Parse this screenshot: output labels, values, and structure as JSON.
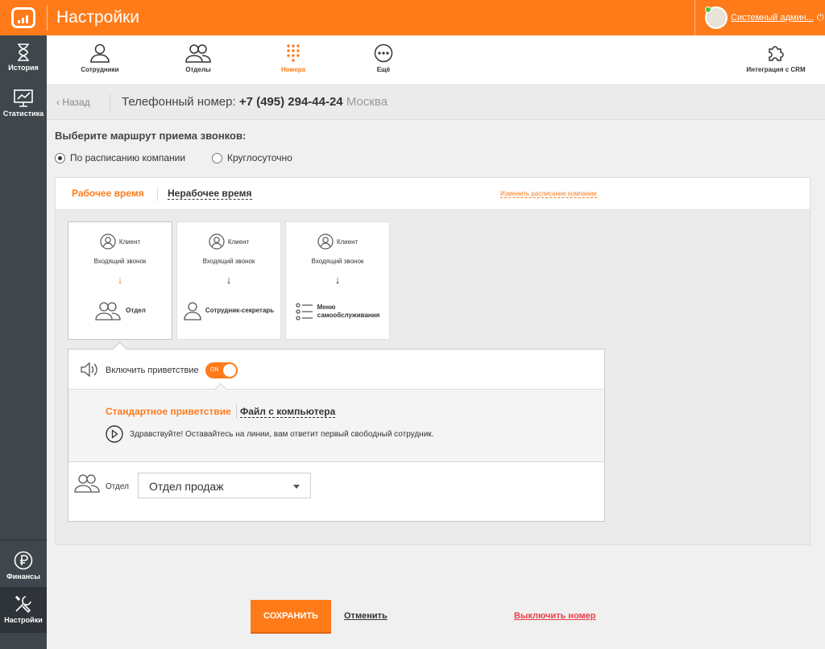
{
  "header": {
    "title": "Настройки",
    "user_name": "Системный админ..."
  },
  "sidebar": {
    "items": [
      {
        "label": "История",
        "icon": "hourglass-icon"
      },
      {
        "label": "Статистика",
        "icon": "chart-icon"
      },
      {
        "label": "Финансы",
        "icon": "ruble-icon"
      },
      {
        "label": "Настройки",
        "icon": "tools-icon"
      }
    ]
  },
  "subnav": {
    "items": [
      {
        "label": "Сотрудники",
        "icon": "user-icon"
      },
      {
        "label": "Отделы",
        "icon": "users-icon"
      },
      {
        "label": "Номера",
        "icon": "keypad-icon"
      },
      {
        "label": "Ещё",
        "icon": "more-icon"
      },
      {
        "label": "Интеграция с CRM",
        "icon": "puzzle-icon"
      }
    ],
    "active": "Номера"
  },
  "breadcrumb": {
    "back": "Назад",
    "prefix": "Телефонный номер:",
    "number": "+7 (495) 294-44-24",
    "city": "Москва"
  },
  "route": {
    "title": "Выберите маршрут приема звонков:",
    "options": [
      "По расписанию компании",
      "Круглосуточно"
    ],
    "selected": "По расписанию компании"
  },
  "schedule_tabs": {
    "active": "Рабочее время",
    "inactive": "Нерабочее время",
    "change_link": "Изменить расписание компании"
  },
  "cards": [
    {
      "client": "Клиент",
      "incoming": "Входящий звонок",
      "arrow": "↓",
      "dest": "Отдел",
      "selected": true
    },
    {
      "client": "Клиент",
      "incoming": "Входящий звонок",
      "arrow": "↓",
      "dest": "Сотрудник-секретарь",
      "selected": false
    },
    {
      "client": "Клиент",
      "incoming": "Входящий звонок",
      "arrow": "↓",
      "dest_line1": "Меню",
      "dest_line2": "самообслуживания",
      "selected": false
    }
  ],
  "greeting": {
    "label": "Включить приветствие",
    "toggle_text": "ON",
    "toggle_on": true,
    "tab_active": "Стандартное приветствие",
    "tab_inactive": "Файл с компьютера",
    "text": "Здравствуйте! Оставайтесь на линии, вам ответит первый свободный сотрудник."
  },
  "department": {
    "label": "Отдел",
    "value": "Отдел продаж"
  },
  "footer": {
    "save": "СОХРАНИТЬ",
    "cancel": "Отменить",
    "disable": "Выключить номер"
  },
  "colors": {
    "accent": "#ff7b1a",
    "sidebar": "#3f474c",
    "danger": "#e8404a"
  }
}
